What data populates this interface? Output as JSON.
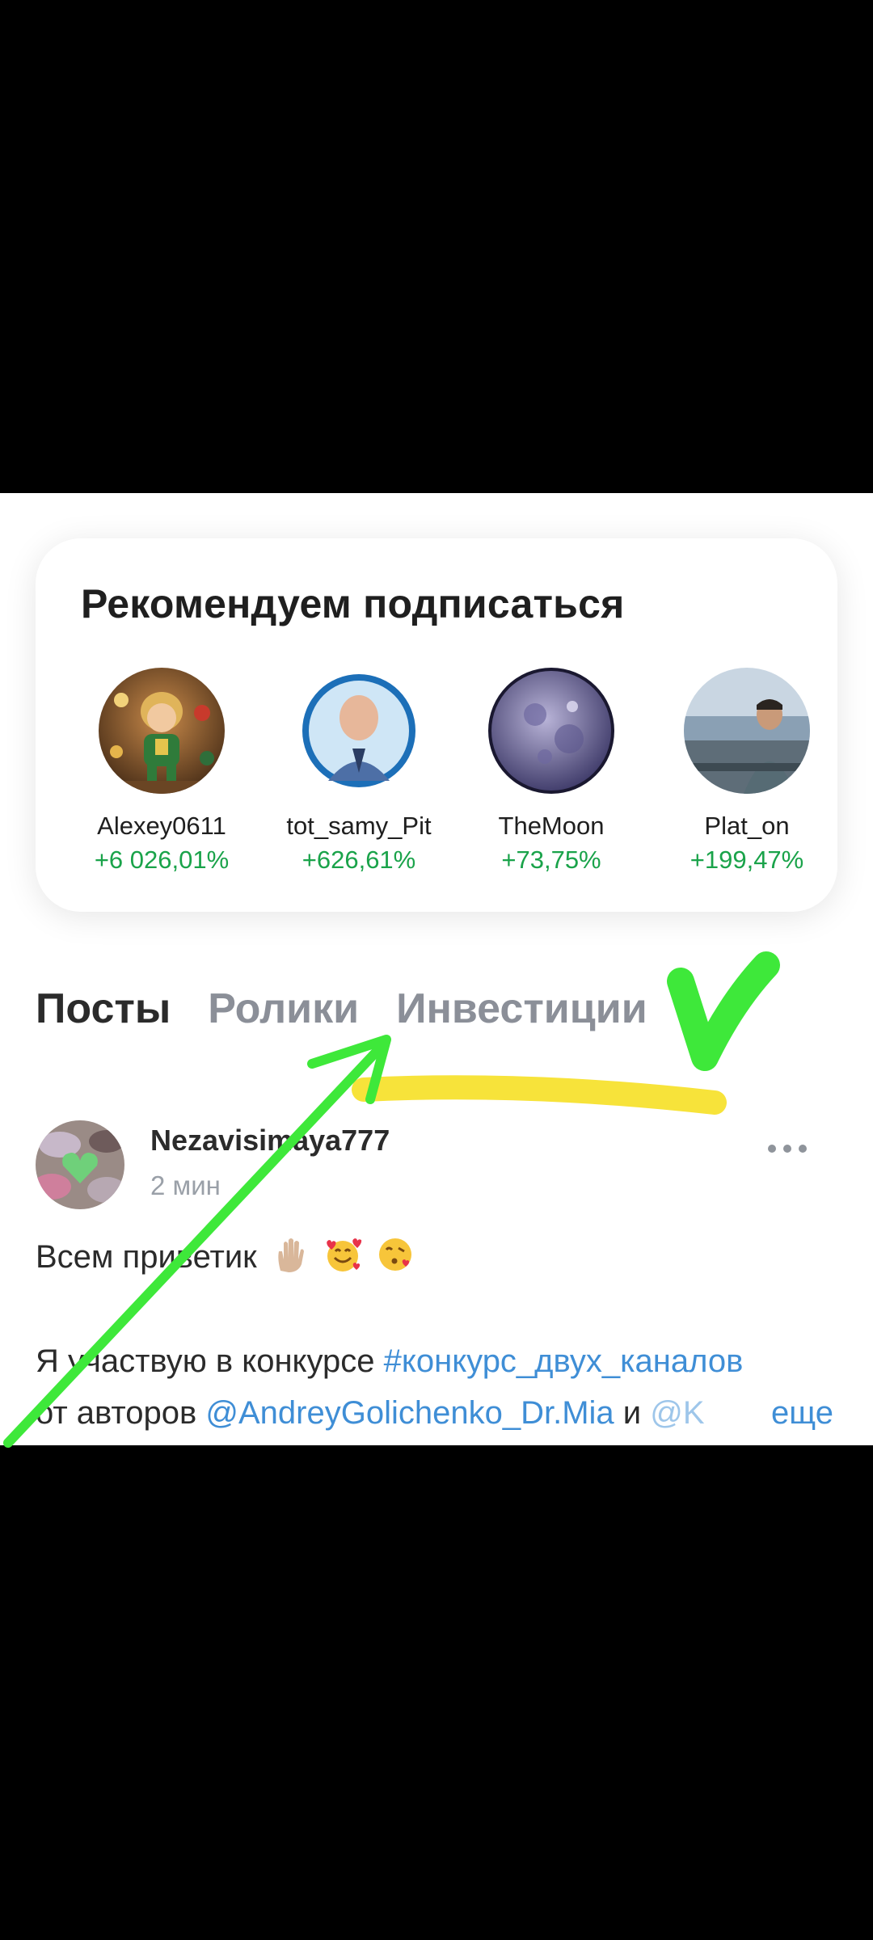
{
  "recommend": {
    "title": "Рекомендуем подписаться",
    "users": [
      {
        "name": "Alexey0611",
        "gain": "+6 026,01%"
      },
      {
        "name": "tot_samy_Pit",
        "gain": "+626,61%"
      },
      {
        "name": "TheMoon",
        "gain": "+73,75%"
      },
      {
        "name": "Plat_on",
        "gain": "+199,47%"
      }
    ]
  },
  "tabs": [
    {
      "label": "Посты",
      "active": true
    },
    {
      "label": "Ролики",
      "active": false
    },
    {
      "label": "Инвестиции",
      "active": false
    }
  ],
  "post": {
    "author": "Nezavisimaya777",
    "time": "2 мин",
    "line1": "Всем приветик",
    "line2_prefix": "Я участвую в конкурсе ",
    "hashtag": "#конкурс_двух_каналов",
    "line3_prefix": "от авторов ",
    "mention1": "@AndreyGolichenko_Dr.Mia",
    "and_word": " и ",
    "mention2": "@K",
    "more_label": "еще"
  },
  "colors": {
    "gain": "#1aa34a",
    "link": "#3f8ed6",
    "annotation_green": "#3ee83a",
    "annotation_yellow": "#f7e33a"
  }
}
